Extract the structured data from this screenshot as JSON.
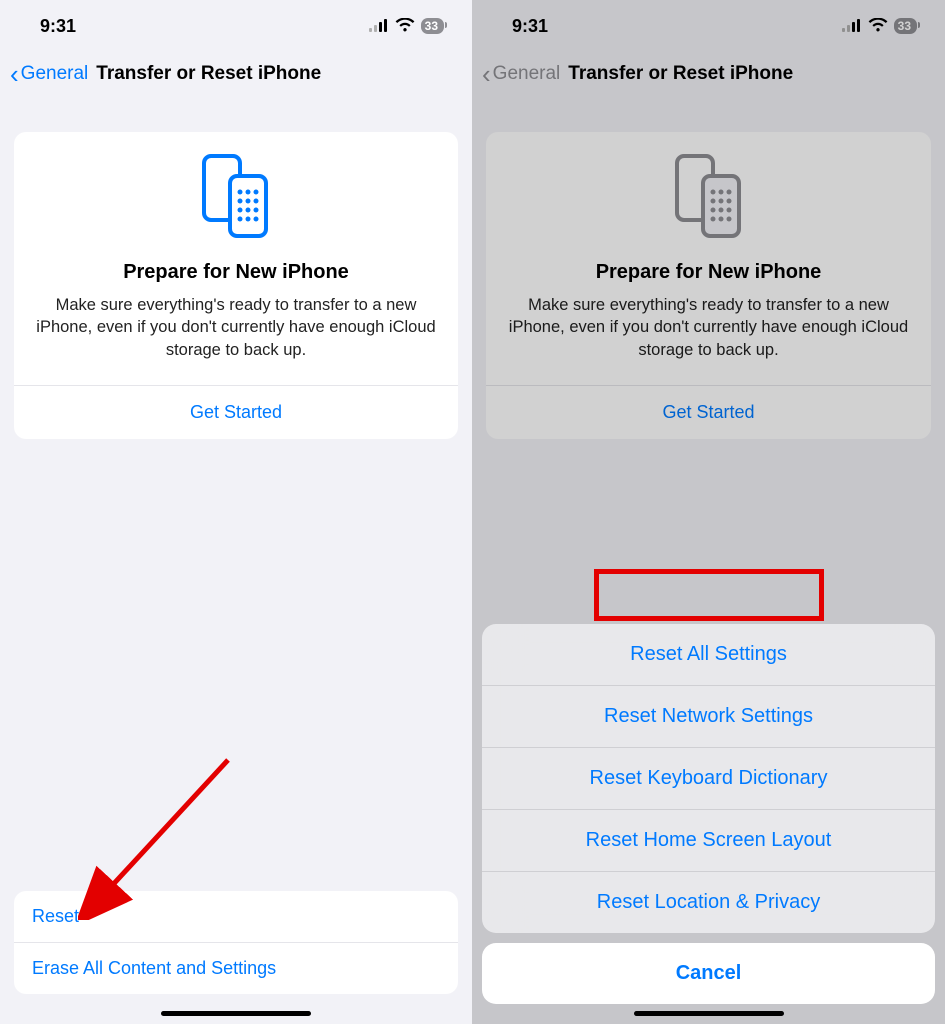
{
  "statusbar": {
    "time": "9:31",
    "battery": "33"
  },
  "nav": {
    "back_label": "General",
    "title": "Transfer or Reset iPhone"
  },
  "card": {
    "heading": "Prepare for New iPhone",
    "body": "Make sure everything's ready to transfer to a new iPhone, even if you don't currently have enough iCloud storage to back up.",
    "cta": "Get Started"
  },
  "bottom": {
    "reset": "Reset",
    "erase": "Erase All Content and Settings"
  },
  "sheet": {
    "items": [
      "Reset All Settings",
      "Reset Network Settings",
      "Reset Keyboard Dictionary",
      "Reset Home Screen Layout",
      "Reset Location & Privacy"
    ],
    "cancel": "Cancel"
  },
  "annotations": {
    "arrow_target": "reset-row",
    "highlight_target": "reset-all-settings"
  }
}
